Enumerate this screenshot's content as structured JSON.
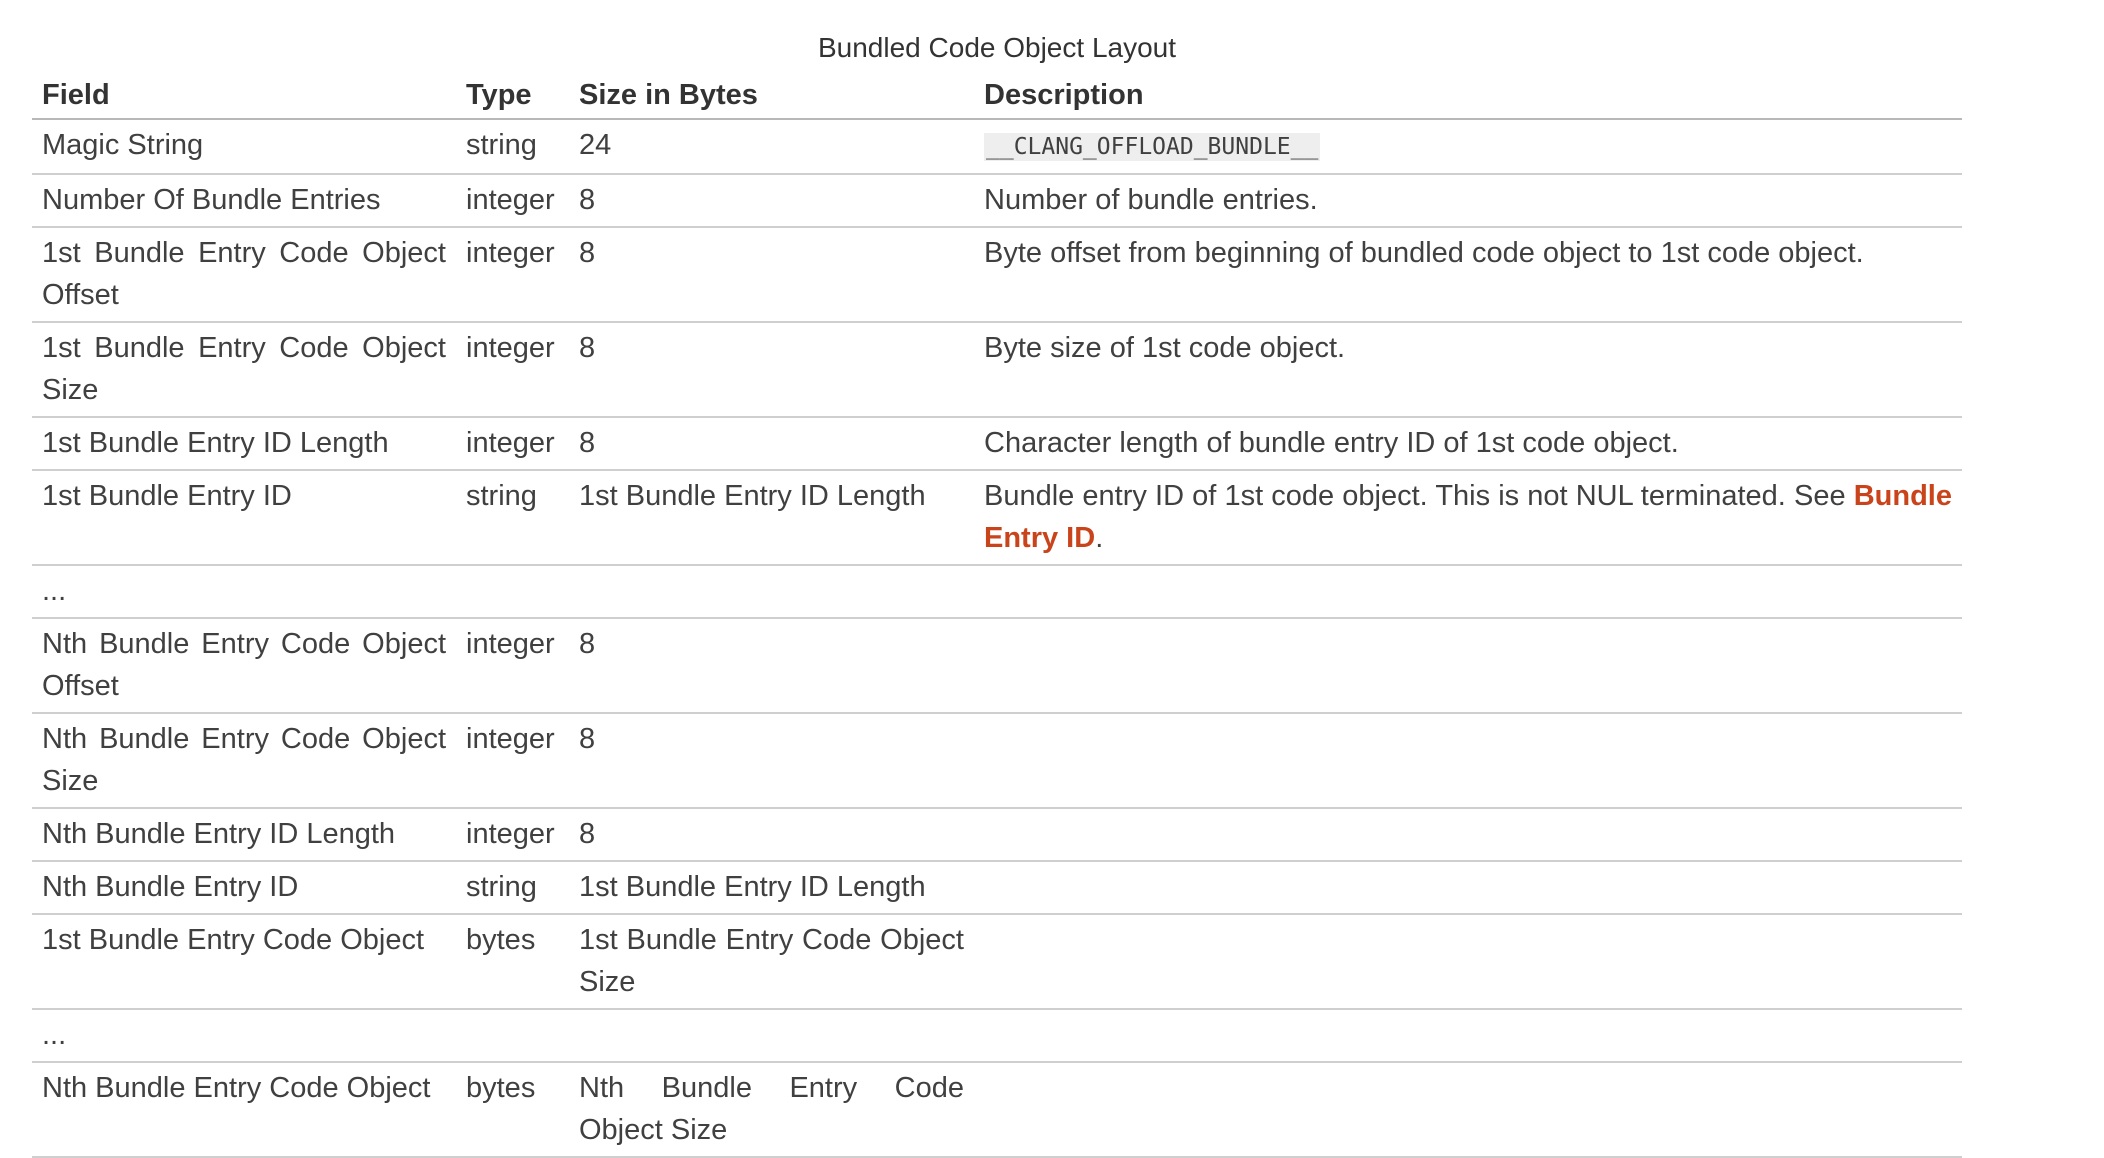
{
  "caption": "Bundled Code Object Layout",
  "headers": {
    "field": "Field",
    "type": "Type",
    "size": "Size in Bytes",
    "description": "Description"
  },
  "rows": [
    {
      "field": "Magic String",
      "type": "string",
      "size": "24",
      "description_code": "__CLANG_OFFLOAD_BUNDLE__"
    },
    {
      "field": "Number Of Bundle Entries",
      "type": "integer",
      "size": "8",
      "description": "Number of bundle entries."
    },
    {
      "field": "1st Bundle Entry Code Object Offset",
      "type": "integer",
      "size": "8",
      "description": "Byte offset from beginning of bundled code object to 1st code object."
    },
    {
      "field": "1st Bundle Entry Code Object Size",
      "type": "integer",
      "size": "8",
      "description": "Byte size of 1st code object."
    },
    {
      "field": "1st Bundle Entry ID Length",
      "type": "integer",
      "size": "8",
      "description": "Character length of bundle entry ID of 1st code object."
    },
    {
      "field": "1st Bundle Entry ID",
      "type": "string",
      "size": "1st Bundle Entry ID Length",
      "description": "Bundle entry ID of 1st code object. This is not NUL terminated. See ",
      "description_link": "Bundle Entry ID",
      "description_after": "."
    },
    {
      "field": "...",
      "type": "",
      "size": "",
      "description": ""
    },
    {
      "field": "Nth Bundle Entry Code Object Offset",
      "type": "integer",
      "size": "8",
      "description": ""
    },
    {
      "field": "Nth Bundle Entry Code Object Size",
      "type": "integer",
      "size": "8",
      "description": ""
    },
    {
      "field": "Nth Bundle Entry ID Length",
      "type": "integer",
      "size": "8",
      "description": ""
    },
    {
      "field": "Nth Bundle Entry ID",
      "type": "string",
      "size": "1st Bundle Entry ID Length",
      "description": ""
    },
    {
      "field": "1st Bundle Entry Code Object",
      "type": "bytes",
      "size": "1st Bundle Entry Code Object Size",
      "description": ""
    },
    {
      "field": "...",
      "type": "",
      "size": "",
      "description": ""
    },
    {
      "field": "Nth Bundle Entry Code Object",
      "type": "bytes",
      "size": "Nth Bundle Entry Code Object Size",
      "description": ""
    }
  ],
  "colors": {
    "link": "#c9441a",
    "text": "#404040",
    "rule": "#cfcfcf"
  }
}
